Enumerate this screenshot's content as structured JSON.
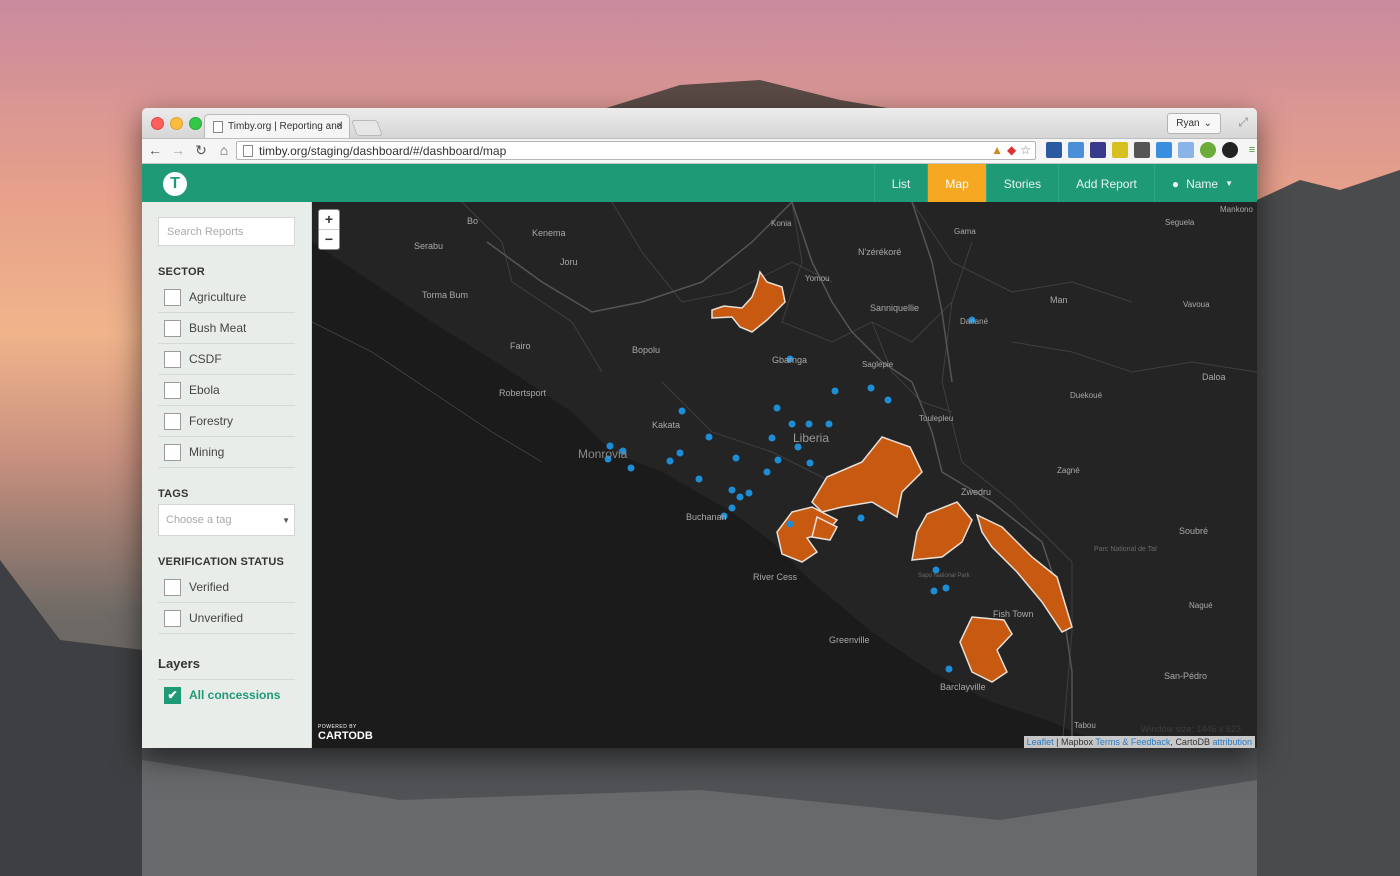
{
  "browser": {
    "tab_title": "Timby.org | Reporting and",
    "url": "timby.org/staging/dashboard/#/dashboard/map",
    "user_button": "Ryan"
  },
  "app": {
    "logo_letter": "T",
    "nav": [
      "List",
      "Map",
      "Stories",
      "Add Report"
    ],
    "active_nav": "Map",
    "user_name": "Name"
  },
  "sidebar": {
    "search_placeholder": "Search Reports",
    "sector_title": "SECTOR",
    "sectors": [
      "Agriculture",
      "Bush Meat",
      "CSDF",
      "Ebola",
      "Forestry",
      "Mining"
    ],
    "tags_title": "TAGS",
    "tags_placeholder": "Choose a tag",
    "verification_title": "VERIFICATION STATUS",
    "verification": [
      "Verified",
      "Unverified"
    ],
    "layers_title": "Layers",
    "layer_all": "All concessions"
  },
  "map": {
    "zoom_in": "+",
    "zoom_out": "−",
    "powered_by": "POWERED BY",
    "cartodb": "CARTODB",
    "window_size": "Window size: 1446 x 623",
    "attribution": {
      "leaflet": "Leaflet",
      "mapbox": "Mapbox",
      "terms": "Terms & Feedback",
      "cartodb": "CartoDB",
      "attrib": "attribution"
    },
    "labels": [
      "Bo",
      "Kenema",
      "Joru",
      "Serabu",
      "Torma Bum",
      "Fairo",
      "Bopolu",
      "Robertsport",
      "Monrovia",
      "Kakata",
      "Buchanan",
      "River Cess",
      "Greenville",
      "Barclayville",
      "Fish Town",
      "Zwedru",
      "Liberia",
      "Gbarnga",
      "Saglepie",
      "Toulepleu",
      "Duekoué",
      "Danané",
      "Man",
      "Sanniquellie",
      "N'zérékoré",
      "Yomou",
      "Gama",
      "Konia",
      "Seguela",
      "Vavoua",
      "Daloa",
      "Zagné",
      "Soubré",
      "Nagué",
      "San-Pédro",
      "Tabou",
      "Mankono",
      "Parc National de Taï",
      "Sapo National Park"
    ]
  }
}
